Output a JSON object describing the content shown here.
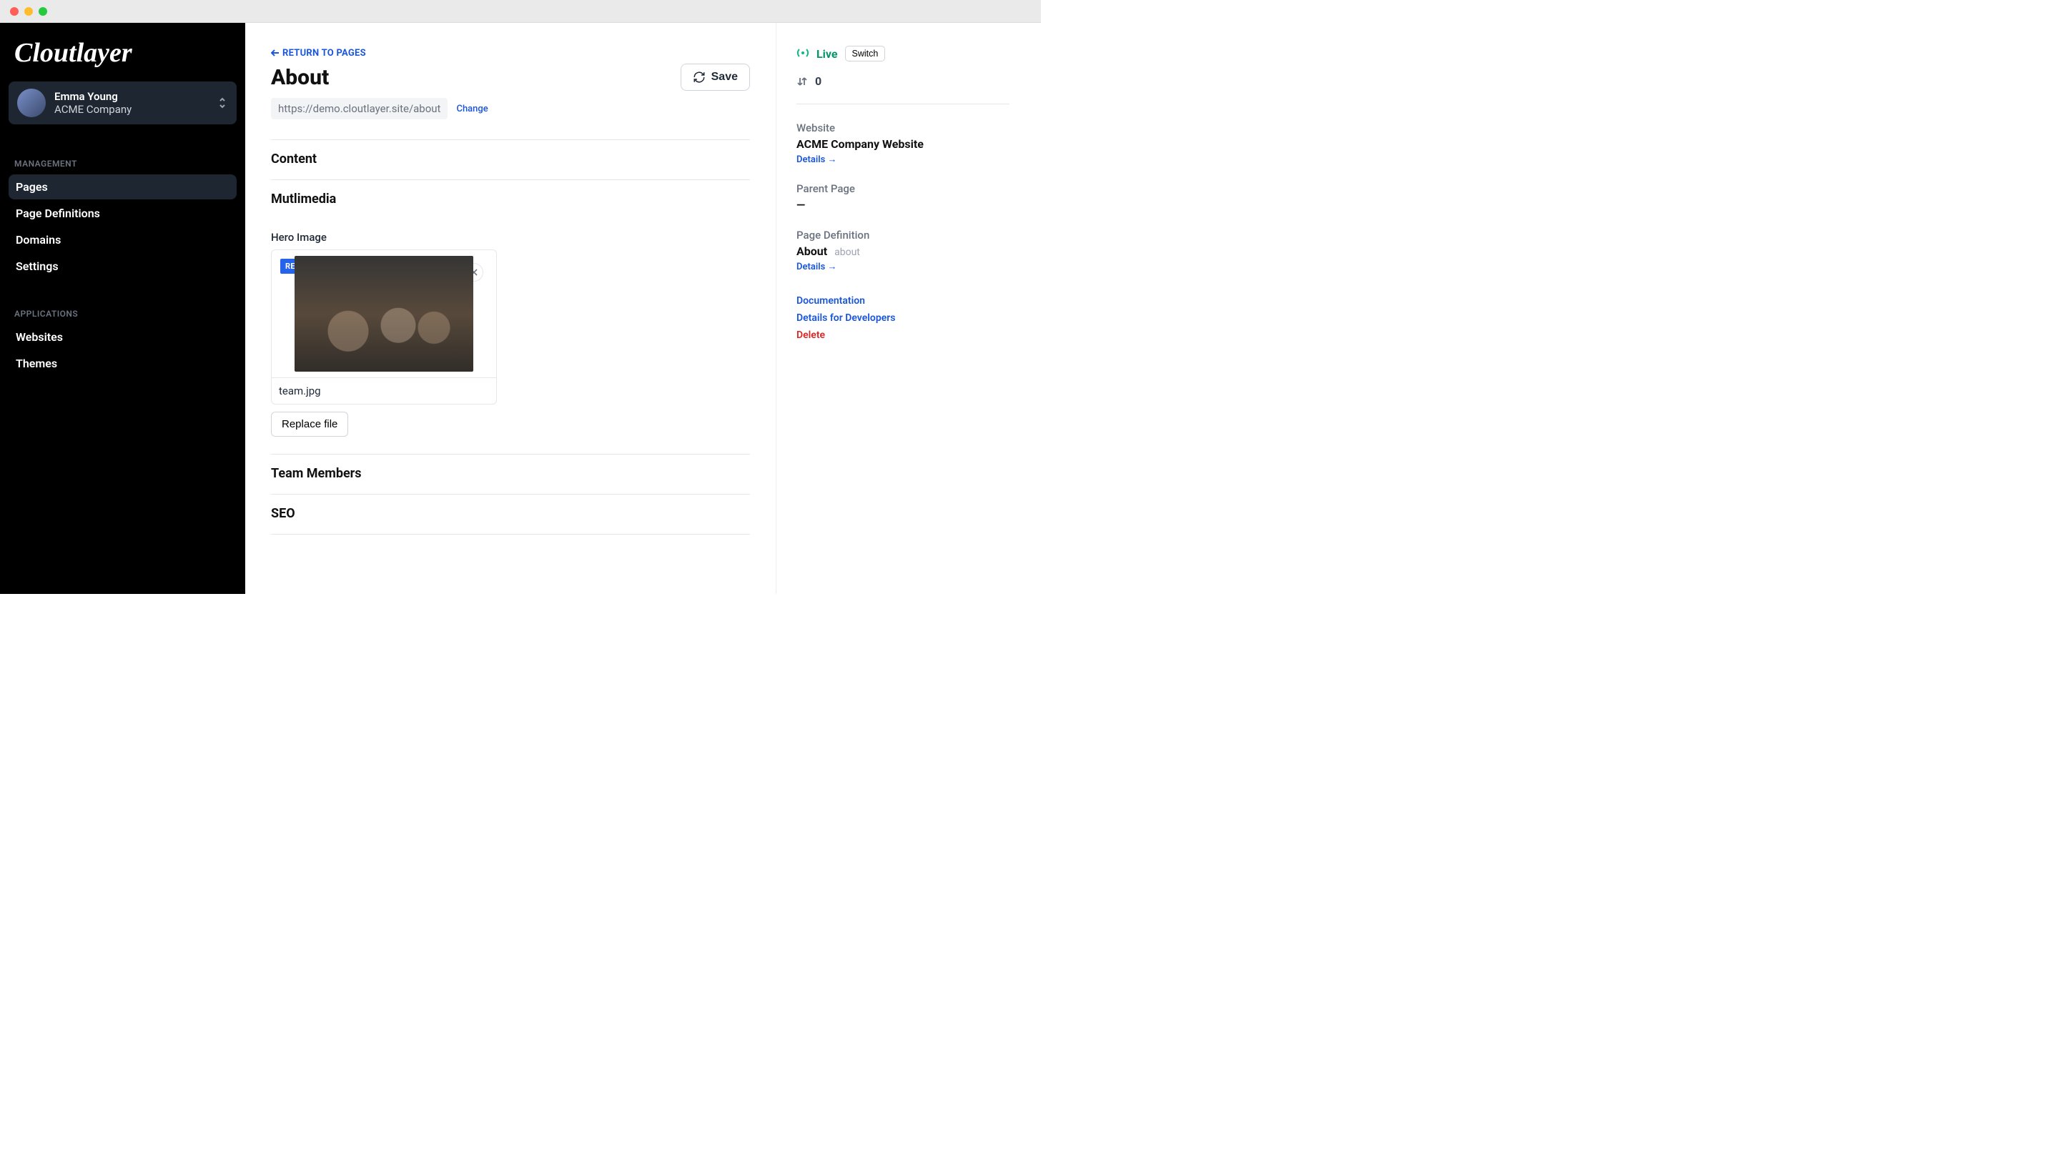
{
  "brand": "Cloutlayer",
  "account": {
    "name": "Emma Young",
    "org": "ACME Company"
  },
  "sidebar": {
    "sections": [
      {
        "label": "MANAGEMENT",
        "items": [
          {
            "label": "Pages",
            "active": true
          },
          {
            "label": "Page Definitions",
            "active": false
          },
          {
            "label": "Domains",
            "active": false
          },
          {
            "label": "Settings",
            "active": false
          }
        ]
      },
      {
        "label": "APPLICATIONS",
        "items": [
          {
            "label": "Websites",
            "active": false
          },
          {
            "label": "Themes",
            "active": false
          }
        ]
      }
    ]
  },
  "header": {
    "return_label": "RETURN TO PAGES",
    "title": "About",
    "save_label": "Save",
    "url": "https://demo.cloutlayer.site/about",
    "change_label": "Change"
  },
  "sections": {
    "content": "Content",
    "multimedia": "Mutlimedia",
    "team_members": "Team Members",
    "seo": "SEO"
  },
  "hero": {
    "label": "Hero Image",
    "badge": "RECENT",
    "filename": "team.jpg",
    "replace_label": "Replace file"
  },
  "sidepanel": {
    "status": {
      "label": "Live",
      "switch_label": "Switch"
    },
    "order": "0",
    "website": {
      "label": "Website",
      "value": "ACME Company Website",
      "details": "Details →"
    },
    "parent": {
      "label": "Parent Page",
      "value": "—"
    },
    "definition": {
      "label": "Page Definition",
      "value": "About",
      "slug": "about",
      "details": "Details →"
    },
    "actions": {
      "docs": "Documentation",
      "dev": "Details for Developers",
      "delete": "Delete"
    }
  }
}
